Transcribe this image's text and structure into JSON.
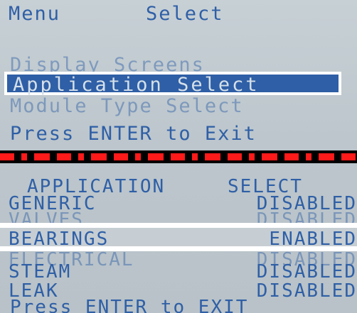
{
  "top_screen": {
    "title_left": "Menu",
    "title_right": "Select",
    "menu_items": [
      "Display Screens",
      "Application Select",
      "Module Type Select"
    ],
    "footer_text": "Press ENTER to Exit"
  },
  "bottom_screen": {
    "header_left": "APPLICATION",
    "header_right": "SELECT",
    "rows": [
      {
        "name": "GENERIC",
        "status": "DISABLED"
      },
      {
        "name": "VALVES",
        "status": "DISABLED"
      },
      {
        "name": "BEARINGS",
        "status": "ENABLED"
      },
      {
        "name": "ELECTRICAL",
        "status": "DISABLED"
      },
      {
        "name": "STEAM",
        "status": "DISABLED"
      },
      {
        "name": "LEAK",
        "status": "DISABLED"
      }
    ],
    "footer_text": "Press ENTER to EXIT"
  },
  "colors": {
    "lcd_text": "#2f5fa6",
    "lcd_background": "#c2cbd1",
    "highlight_frame": "#ffffff",
    "divider_dash": "#ff1a1a"
  }
}
